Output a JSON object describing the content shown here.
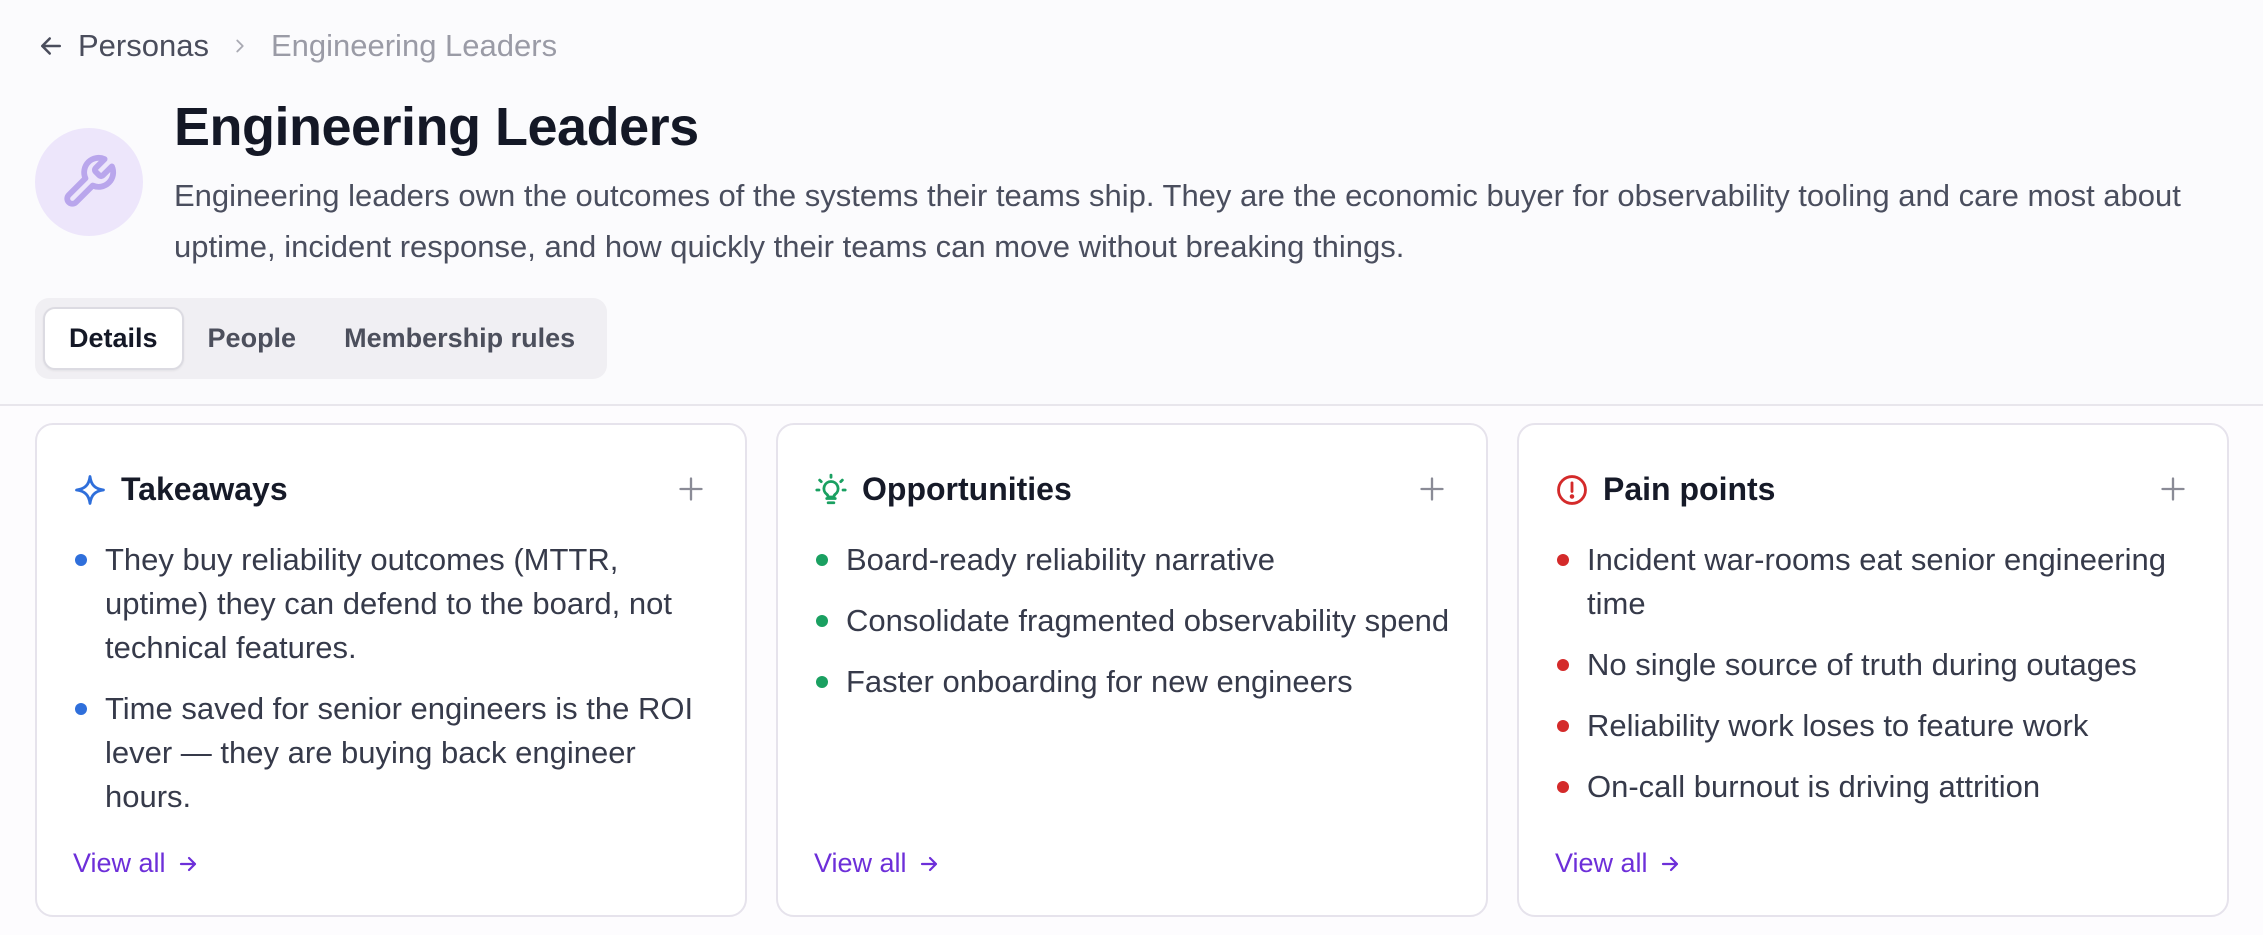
{
  "breadcrumb": {
    "parent": "Personas",
    "current": "Engineering Leaders"
  },
  "header": {
    "title": "Engineering Leaders",
    "description": "Engineering leaders own the outcomes of the systems their teams ship. They are the economic buyer for observability tooling and care most about uptime, incident response, and how quickly their teams can move without breaking things.",
    "avatar_icon": "wrench-icon"
  },
  "tabs": [
    {
      "label": "Details",
      "active": true
    },
    {
      "label": "People",
      "active": false
    },
    {
      "label": "Membership rules",
      "active": false
    }
  ],
  "cards": {
    "takeaways": {
      "title": "Takeaways",
      "icon": "sparkle-icon",
      "color": "#2f6fdb",
      "items": [
        "They buy reliability outcomes (MTTR, uptime) they can defend to the board, not technical features.",
        "Time saved for senior engineers is the ROI lever — they are buying back engineer hours."
      ],
      "view_all": "View all"
    },
    "opportunities": {
      "title": "Opportunities",
      "icon": "lightbulb-icon",
      "color": "#1aa061",
      "items": [
        "Board-ready reliability narrative",
        "Consolidate fragmented observability spend",
        "Faster onboarding for new engineers"
      ],
      "view_all": "View all"
    },
    "pain_points": {
      "title": "Pain points",
      "icon": "alert-circle-icon",
      "color": "#d42a2a",
      "items": [
        "Incident war-rooms eat senior engineering time",
        "No single source of truth during outages",
        "Reliability work loses to feature work",
        "On-call burnout is driving attrition"
      ],
      "view_all": "View all"
    }
  },
  "colors": {
    "accent": "#6d2fd9",
    "avatar_bg": "#ede6fb"
  }
}
